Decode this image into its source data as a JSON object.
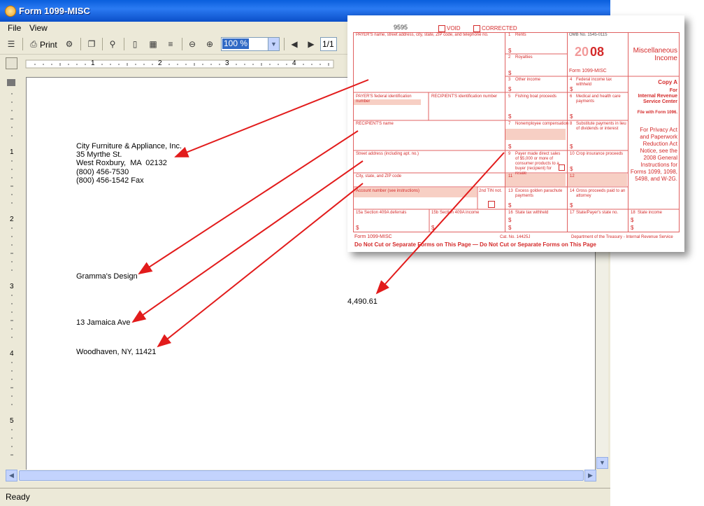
{
  "window": {
    "title": "Form 1099-MISC"
  },
  "menu": [
    "File",
    "View"
  ],
  "toolbar": {
    "print_label": "Print",
    "zoom_value": "100 %",
    "page_value": "1/1"
  },
  "ruler": {
    "h_numbers": [
      "1",
      "2",
      "3",
      "4"
    ],
    "v_numbers": [
      "1",
      "2",
      "3",
      "4",
      "5"
    ]
  },
  "document": {
    "payer_lines": [
      "City Furniture & Appliance, Inc.",
      "35 Myrthe St.",
      "West Roxbury,  MA  02132",
      "(800) 456-7530",
      "(800) 456-1542 Fax"
    ],
    "recipient_name": "Gramma's Design",
    "street": "13 Jamaica Ave",
    "city": "Woodhaven, NY, 11421",
    "amount": "4,490.61"
  },
  "status": "Ready",
  "form": {
    "code": "9595",
    "void": "VOID",
    "corrected": "CORRECTED",
    "payer_box": "PAYER'S name, street address, city, state, ZIP code, and telephone no.",
    "rents": "Rents",
    "royalties": "Royalties",
    "omb": "OMB No. 1545-0115",
    "year_a": "20",
    "year_b": "08",
    "form_name_small": "Form 1099-MISC",
    "title1": "Miscellaneous",
    "title2": "Income",
    "other_income": "Other income",
    "fed_tax": "Federal income tax withheld",
    "copy_a": "Copy A",
    "for": "For",
    "irs1": "Internal Revenue",
    "irs2": "Service Center",
    "file_with": "File with Form 1096.",
    "payer_fid": "PAYER'S federal identification number",
    "recip_id": "RECIPIENT'S identification number",
    "fishing": "Fishing boat proceeds",
    "medical": "Medical and health care payments",
    "privacy": "For Privacy Act and Paperwork Reduction Act Notice, see the 2008 General Instructions for Forms 1099, 1098, 5498, and W-2G.",
    "recip_name": "RECIPIENT'S name",
    "nonemp": "Nonemployee compensation",
    "substitute": "Substitute payments in lieu of dividends or interest",
    "street": "Street address (including apt. no.)",
    "direct_sales": "Payer made direct sales of $5,000 or more of consumer products to a buyer (recipient) for resale",
    "crop": "Crop insurance proceeds",
    "city": "City, state, and ZIP code",
    "acct": "Account number (see instructions)",
    "tin": "2nd TIN not.",
    "golden": "Excess golden parachute payments",
    "gross": "Gross proceeds paid to an attorney",
    "s409a_def": "Section 409A deferrals",
    "s409a_inc": "Section 409A income",
    "state_tax": "State tax withheld",
    "state_no": "State/Payer's state no.",
    "state_income": "State income",
    "form_foot": "Form 1099-MISC",
    "cat": "Cat. No. 14425J",
    "dept": "Department of the Treasury - Internal Revenue Service",
    "do_not_cut": "Do  Not  Cut  or  Separate  Forms  on  This  Page   —   Do  Not  Cut  or  Separate  Forms  on  This  Page",
    "box_nums": [
      "1",
      "2",
      "3",
      "4",
      "5",
      "6",
      "7",
      "8",
      "9",
      "10",
      "11",
      "12",
      "13",
      "14",
      "15a",
      "15b",
      "16",
      "17",
      "18"
    ],
    "dollar": "$"
  }
}
